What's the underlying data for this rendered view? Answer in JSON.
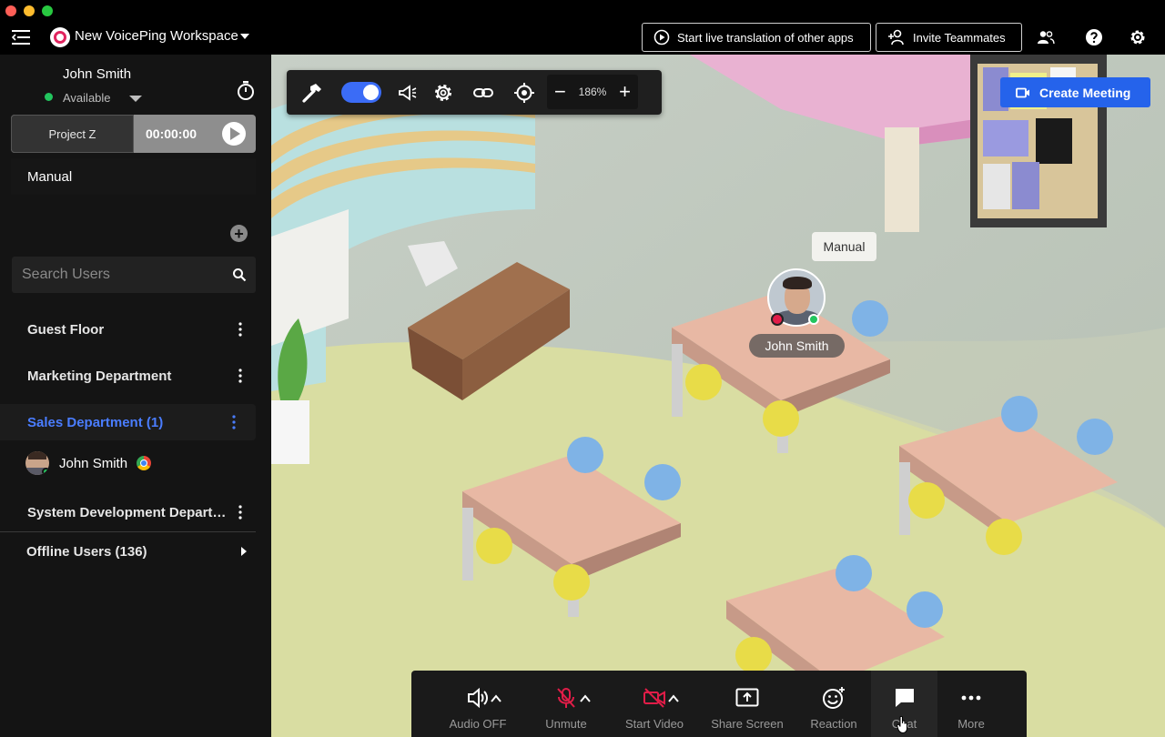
{
  "workspace": {
    "name": "New VoicePing Workspace"
  },
  "header": {
    "translate_label": "Start live translation of other apps",
    "invite_label": "Invite Teammates"
  },
  "user": {
    "name": "John Smith",
    "status": "Available"
  },
  "project": {
    "name": "Project Z",
    "time": "00:00:00"
  },
  "work_mode": "Manual",
  "search": {
    "placeholder": "Search Users"
  },
  "floors": [
    {
      "name": "Guest Floor"
    },
    {
      "name": "Marketing Department"
    },
    {
      "name": "Sales Department (1)"
    },
    {
      "name": "System Development Depart…"
    },
    {
      "name": "Offline Users (136)"
    }
  ],
  "members": [
    {
      "name": "John Smith"
    }
  ],
  "map": {
    "zoom": "186%",
    "create_meeting_label": "Create Meeting",
    "status_bubble": "Manual",
    "avatar_name": "John Smith"
  },
  "controls": [
    {
      "label": "Audio OFF"
    },
    {
      "label": "Unmute"
    },
    {
      "label": "Start Video"
    },
    {
      "label": "Share Screen"
    },
    {
      "label": "Reaction"
    },
    {
      "label": "Chat"
    },
    {
      "label": "More"
    }
  ],
  "colors": {
    "accent": "#2563eb",
    "active_floor": "#4a7dff",
    "mute_red": "#e11d48",
    "online_green": "#22c55e"
  }
}
